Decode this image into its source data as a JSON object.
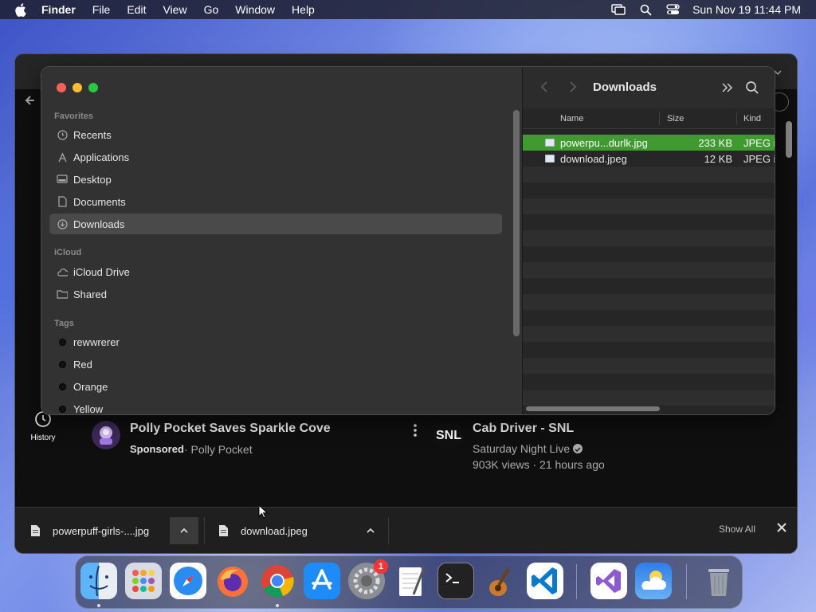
{
  "menubar": {
    "app_name": "Finder",
    "items": [
      "File",
      "Edit",
      "View",
      "Go",
      "Window",
      "Help"
    ],
    "datetime": "Sun Nov 19  11:44 PM"
  },
  "finder": {
    "favorites_header": "Favorites",
    "favorites": [
      {
        "label": "Recents",
        "icon": "clock-icon"
      },
      {
        "label": "Applications",
        "icon": "apps-icon"
      },
      {
        "label": "Desktop",
        "icon": "desktop-icon"
      },
      {
        "label": "Documents",
        "icon": "document-icon"
      },
      {
        "label": "Downloads",
        "icon": "download-icon",
        "selected": true
      }
    ],
    "icloud_header": "iCloud",
    "icloud": [
      {
        "label": "iCloud Drive",
        "icon": "cloud-icon"
      },
      {
        "label": "Shared",
        "icon": "shared-folder-icon"
      }
    ],
    "tags_header": "Tags",
    "tags": [
      {
        "label": "rewwrerer"
      },
      {
        "label": "Red"
      },
      {
        "label": "Orange"
      },
      {
        "label": "Yellow"
      }
    ],
    "location_title": "Downloads",
    "columns": {
      "name": "Name",
      "size": "Size",
      "kind": "Kind"
    },
    "files": [
      {
        "name": "powerpu...durlk.jpg",
        "size": "233 KB",
        "kind": "JPEG i",
        "selected": true
      },
      {
        "name": "download.jpeg",
        "size": "12 KB",
        "kind": "JPEG i",
        "selected": false
      }
    ]
  },
  "youtube": {
    "history_label": "History",
    "video1": {
      "title": "Polly Pocket Saves Sparkle Cove",
      "sponsored": "Sponsored",
      "channel": "· Polly Pocket"
    },
    "video2": {
      "title": "Cab Driver - SNL",
      "channel": "Saturday Night Live",
      "stats": "903K views · 21 hours ago",
      "avatar_text": "SNL"
    }
  },
  "downloads": {
    "items": [
      {
        "name": "powerpuff-girls-....jpg"
      },
      {
        "name": "download.jpeg"
      }
    ],
    "show_all": "Show All"
  },
  "dock": {
    "settings_badge": "1"
  },
  "colors": {
    "selection_green": "#3f9a2f",
    "close": "#ff5f57",
    "minimize": "#febc2e",
    "zoom": "#28c840"
  }
}
